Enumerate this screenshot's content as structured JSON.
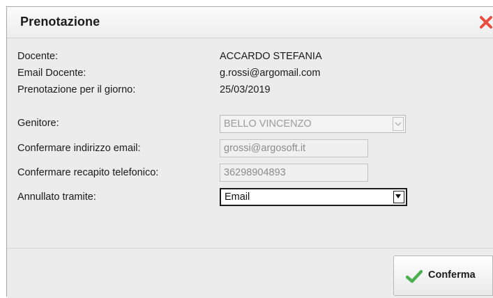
{
  "dialog": {
    "title": "Prenotazione",
    "close_icon": "close-icon"
  },
  "form": {
    "docente_label": "Docente:",
    "docente_value": "ACCARDO STEFANIA",
    "email_docente_label": "Email Docente:",
    "email_docente_value": "g.rossi@argomail.com",
    "giorno_label": "Prenotazione per il giorno:",
    "giorno_value": "25/03/2019",
    "genitore_label": "Genitore:",
    "genitore_value": "BELLO VINCENZO",
    "conferma_email_label": "Confermare indirizzo email:",
    "conferma_email_value": "grossi@argosoft.it",
    "conferma_telefono_label": "Confermare recapito telefonico:",
    "conferma_telefono_value": "36298904893",
    "annullato_label": "Annullato tramite:",
    "annullato_value": "Email"
  },
  "footer": {
    "confirm_label": "Conferma",
    "confirm_icon": "check-icon"
  },
  "colors": {
    "close_icon": "#e74c3c",
    "check_icon": "#4caf50",
    "dialog_background": "#ececec"
  }
}
